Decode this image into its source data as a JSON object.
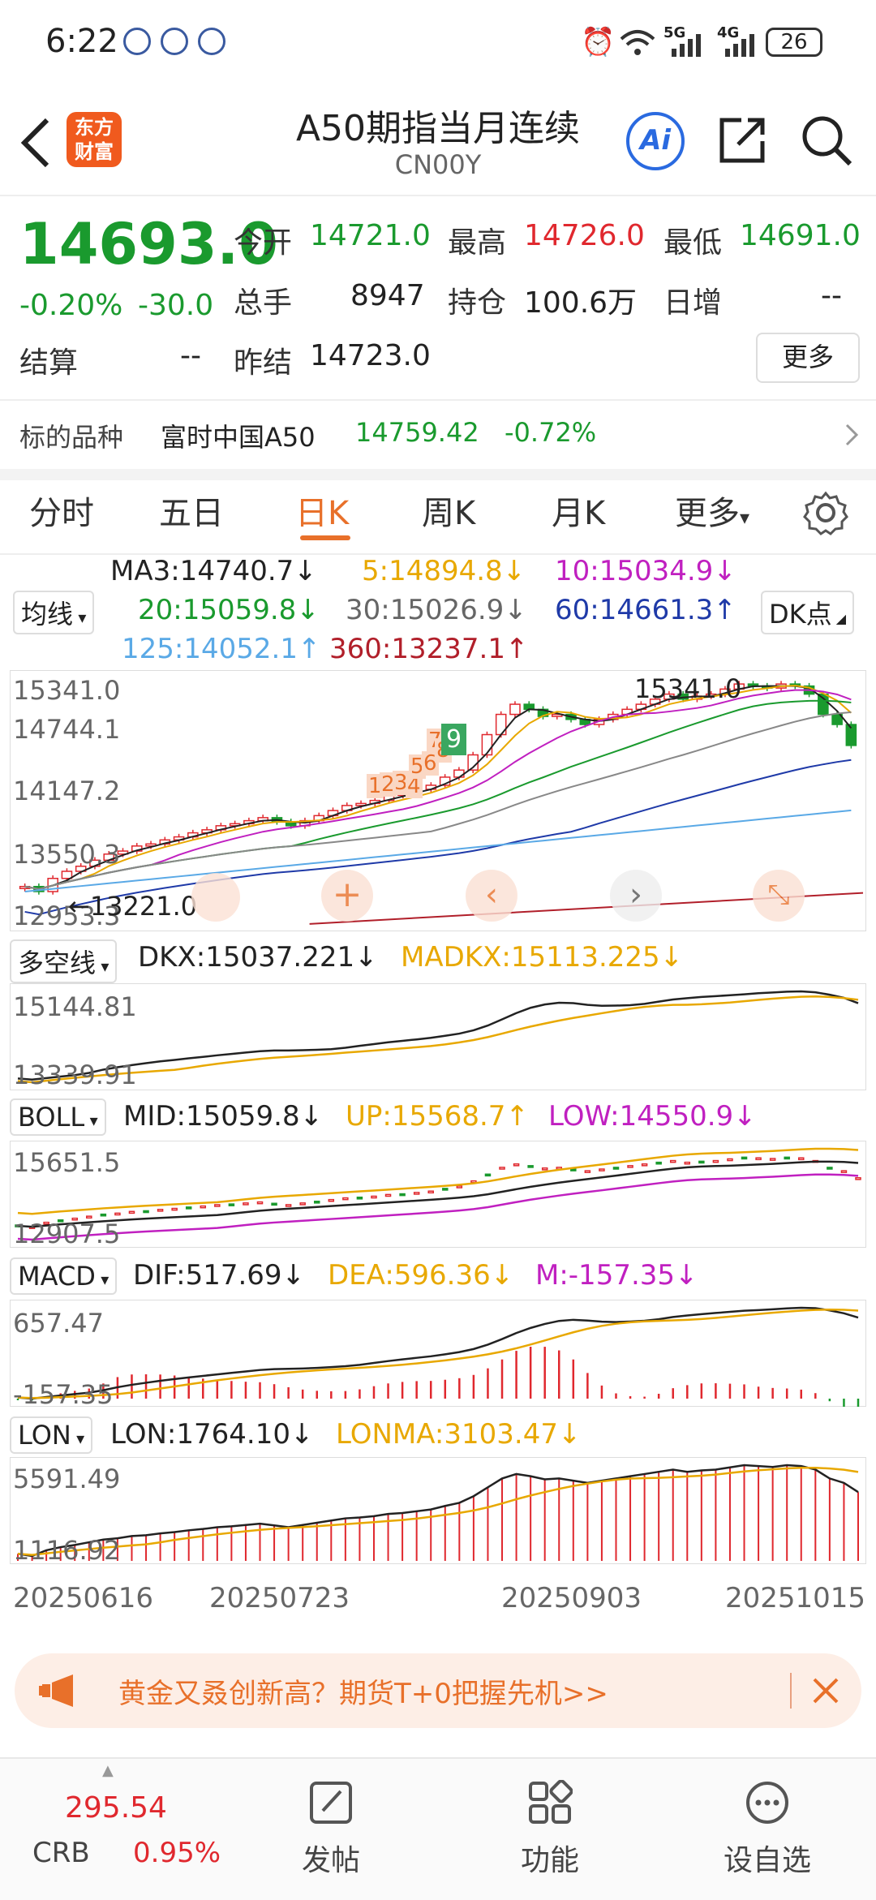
{
  "status": {
    "time": "6:22",
    "network1": "5G",
    "network2": "4G",
    "battery": "26"
  },
  "header": {
    "back_icon": "back-arrow-icon",
    "logo_text": "东方财富",
    "title": "A50期指当月连续",
    "code": "CN00Y",
    "ai_label": "Ai"
  },
  "quote": {
    "price": "14693.0",
    "change_pct": "-0.20%",
    "change": "-30.0",
    "open_label": "今开",
    "open": "14721.0",
    "high_label": "最高",
    "high": "14726.0",
    "low_label": "最低",
    "low": "14691.0",
    "volume_label": "总手",
    "volume": "8947",
    "oi_label": "持仓",
    "oi": "100.6万",
    "daily_inc_label": "日增",
    "daily_inc": "--",
    "settle_label": "结算",
    "settle": "--",
    "prev_settle_label": "昨结",
    "prev_settle": "14723.0",
    "more_label": "更多"
  },
  "underlying": {
    "label": "标的品种",
    "name": "富时中国A50",
    "price": "14759.42",
    "pct": "-0.72%"
  },
  "tabs": [
    {
      "label": "分时"
    },
    {
      "label": "五日"
    },
    {
      "label": "日K"
    },
    {
      "label": "周K"
    },
    {
      "label": "月K"
    },
    {
      "label": "更多"
    }
  ],
  "ma": {
    "selector": "均线",
    "ma3": "MA3:14740.7↓",
    "ma5": "5:14894.8↓",
    "ma10": "10:15034.9↓",
    "ma20": "20:15059.8↓",
    "ma30": "30:15026.9↓",
    "ma60": "60:14661.3↑",
    "ma125": "125:14052.1↑",
    "ma360": "360:13237.1↑",
    "dk_button": "DK点"
  },
  "main_chart": {
    "ticks": [
      "15341.0",
      "14744.1",
      "14147.2",
      "13550.3",
      "12953.3"
    ],
    "max_label": "15341.0",
    "min_label": "13221.0",
    "seq_labels": [
      "1",
      "2",
      "3",
      "4",
      "5",
      "6",
      "7",
      "8",
      "9"
    ]
  },
  "dkx": {
    "selector": "多空线",
    "dkx": "DKX:15037.221↓",
    "madkx": "MADKX:15113.225↓",
    "ticks": [
      "15144.81",
      "13339.91"
    ]
  },
  "boll": {
    "selector": "BOLL",
    "mid": "MID:15059.8↓",
    "up": "UP:15568.7↑",
    "low": "LOW:14550.9↓",
    "ticks": [
      "15651.5",
      "12907.5"
    ]
  },
  "macd": {
    "selector": "MACD",
    "dif": "DIF:517.69↓",
    "dea": "DEA:596.36↓",
    "m": "M:-157.35↓",
    "ticks": [
      "657.47",
      "-157.35"
    ]
  },
  "lon": {
    "selector": "LON",
    "lon": "LON:1764.10↓",
    "lonma": "LONMA:3103.47↓",
    "ticks": [
      "5591.49",
      "1116.92"
    ]
  },
  "dates": [
    "20250616",
    "20250723",
    "20250903",
    "20251015"
  ],
  "banner": {
    "text": "黄金又叒创新高？期货T+0把握先机>>"
  },
  "bottom_nav": {
    "crb_value": "295.54",
    "crb_label": "CRB",
    "crb_pct": "0.95%",
    "post": "发帖",
    "func": "功能",
    "watch": "设自选"
  },
  "chart_data": {
    "type": "line",
    "title": "",
    "x_labels": [
      "20250616",
      "20250723",
      "20250903",
      "20251015"
    ],
    "ylim": [
      12953.3,
      15341.0
    ],
    "series": [
      {
        "name": "MA3",
        "last": 14740.7
      },
      {
        "name": "5",
        "last": 14894.8
      },
      {
        "name": "10",
        "last": 15034.9
      },
      {
        "name": "20",
        "last": 15059.8
      },
      {
        "name": "30",
        "last": 15026.9
      },
      {
        "name": "60",
        "last": 14661.3
      },
      {
        "name": "125",
        "last": 14052.1
      },
      {
        "name": "360",
        "last": 13237.1
      }
    ],
    "close_approx": [
      13300,
      13250,
      13380,
      13450,
      13500,
      13560,
      13620,
      13650,
      13700,
      13720,
      13760,
      13790,
      13830,
      13860,
      13900,
      13920,
      13950,
      13980,
      13940,
      13900,
      13950,
      14000,
      14050,
      14100,
      14120,
      14150,
      14200,
      14220,
      14260,
      14300,
      14380,
      14450,
      14600,
      14800,
      15000,
      15100,
      15050,
      14980,
      15000,
      14950,
      14900,
      14950,
      15000,
      15050,
      15100,
      15150,
      15200,
      15150,
      15180,
      15200,
      15250,
      15300,
      15280,
      15260,
      15300,
      15280,
      15200,
      15000,
      14900,
      14693
    ],
    "high_label": 15341.0,
    "low_label": 13221.0
  }
}
